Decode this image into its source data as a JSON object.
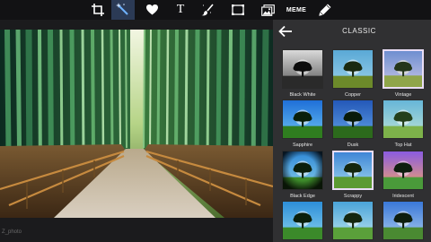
{
  "toolbar": {
    "tools": [
      {
        "name": "crop-icon",
        "active": false
      },
      {
        "name": "magic-wand-icon",
        "active": true
      },
      {
        "name": "heart-icon",
        "active": false
      },
      {
        "name": "text-icon",
        "active": false,
        "label": "T"
      },
      {
        "name": "brush-icon",
        "active": false
      },
      {
        "name": "frame-icon",
        "active": false
      },
      {
        "name": "image-icon",
        "active": false
      },
      {
        "name": "meme-icon",
        "active": false,
        "label": "MEME"
      },
      {
        "name": "pen-icon",
        "active": false
      }
    ]
  },
  "canvas": {
    "image": "bamboo forest path",
    "watermark": "Z_photo"
  },
  "panel": {
    "title": "CLASSIC",
    "presets": [
      {
        "label": "Black White",
        "style": "bw",
        "selected": false
      },
      {
        "label": "Copper",
        "style": "copper",
        "selected": false
      },
      {
        "label": "Vintage",
        "style": "vintage",
        "selected": true
      },
      {
        "label": "Sapphire",
        "style": "sapphire",
        "selected": false
      },
      {
        "label": "Dusk",
        "style": "dusk",
        "selected": false
      },
      {
        "label": "Top Hat",
        "style": "tophat",
        "selected": false
      },
      {
        "label": "Black Edge",
        "style": "blackedge",
        "selected": false
      },
      {
        "label": "Scrappy",
        "style": "scrappy",
        "selected": true
      },
      {
        "label": "Iridescent",
        "style": "iridescent",
        "selected": false
      },
      {
        "label": "",
        "style": "row4a",
        "selected": false
      },
      {
        "label": "",
        "style": "row4b",
        "selected": false
      },
      {
        "label": "",
        "style": "row4c",
        "selected": false
      }
    ]
  },
  "colors": {
    "toolbar_bg": "#121214",
    "panel_bg": "#303032",
    "active_tool_bg": "#2b3a55",
    "selected_border": "#e9ddf5"
  }
}
